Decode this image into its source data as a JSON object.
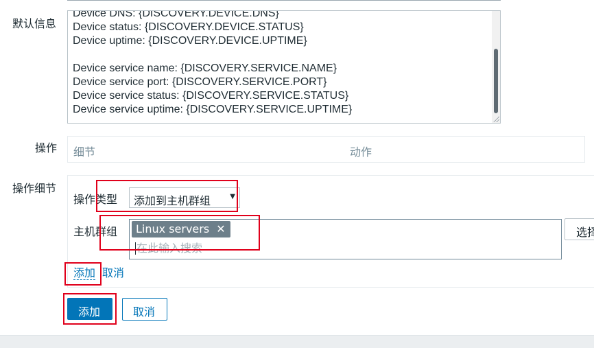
{
  "form": {
    "default_message_label": "默认信息",
    "default_message_lines": [
      "Device DNS: {DISCOVERY.DEVICE.DNS}",
      "Device status: {DISCOVERY.DEVICE.STATUS}",
      "Device uptime: {DISCOVERY.DEVICE.UPTIME}",
      "",
      "Device service name: {DISCOVERY.SERVICE.NAME}",
      "Device service port: {DISCOVERY.SERVICE.PORT}",
      "Device service status: {DISCOVERY.SERVICE.STATUS}",
      "Device service uptime: {DISCOVERY.SERVICE.UPTIME}"
    ],
    "operations_label": "操作",
    "operations_columns": [
      "细节",
      "动作"
    ],
    "operation_details_label": "操作细节",
    "operation_type_label": "操作类型",
    "operation_type_value": "添加到主机群组",
    "host_group_label": "主机群组",
    "host_group_chip": "Linux servers",
    "host_group_chip_remove": "✕",
    "host_group_placeholder": "在此输入搜索",
    "select_button": "选择",
    "add_link": "添加",
    "cancel_link": "取消",
    "add_button": "添加",
    "cancel_button": "取消"
  },
  "colors": {
    "accent": "#0275b8",
    "chip": "#6d7f8a",
    "highlight": "#e0001b"
  }
}
